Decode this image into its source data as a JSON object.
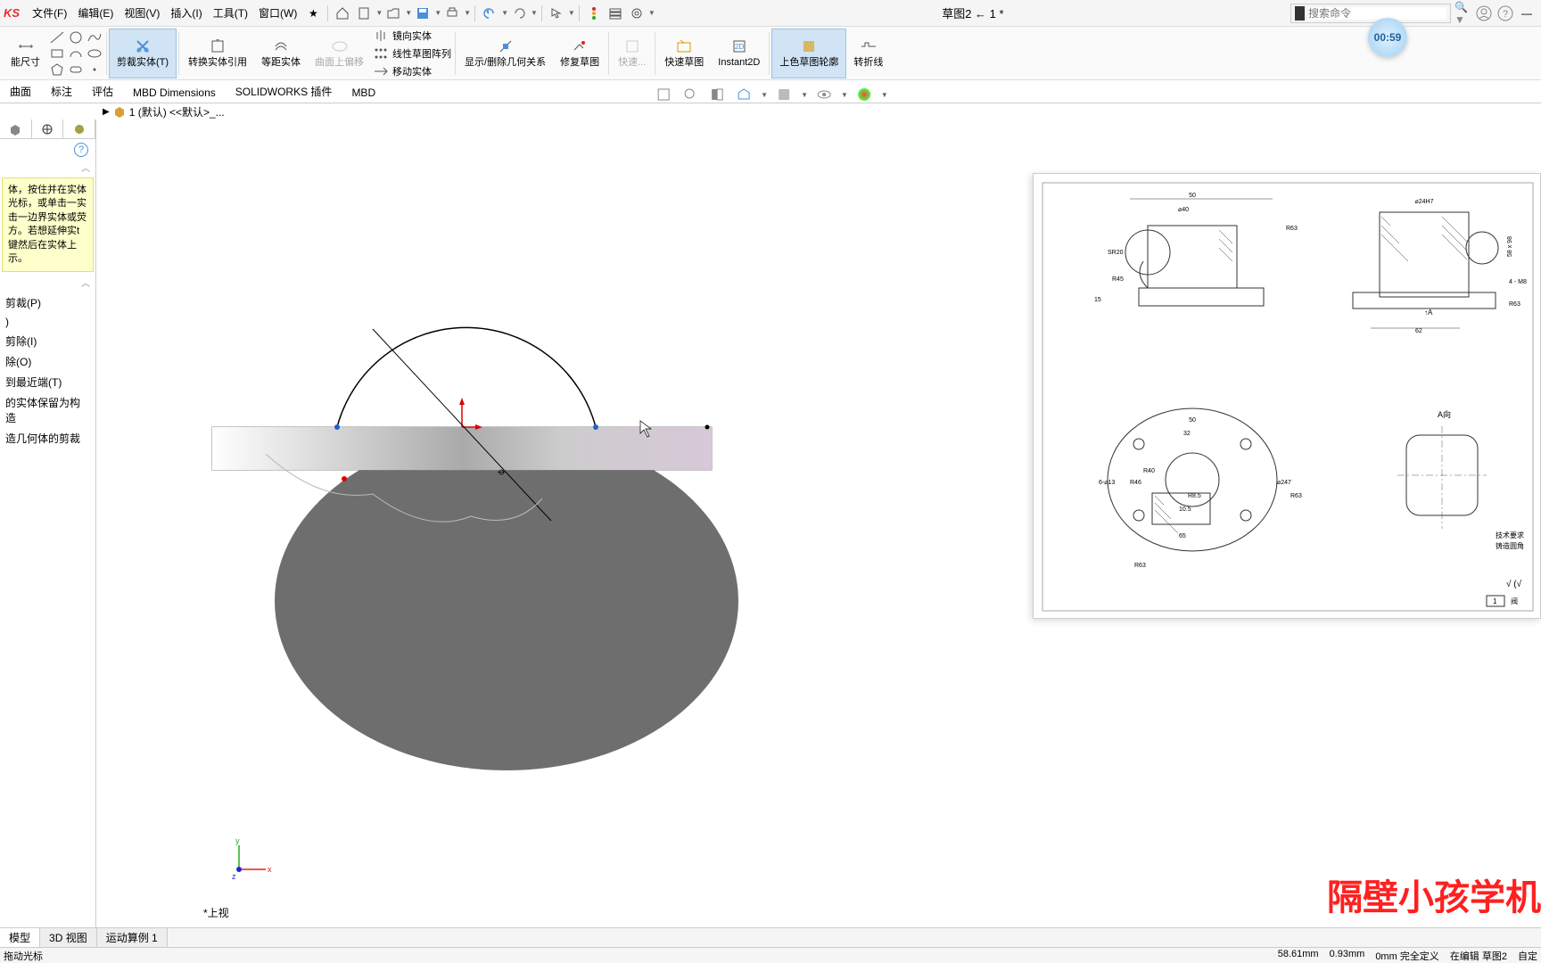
{
  "app": {
    "logo": "KS"
  },
  "menu": {
    "file": "文件(F)",
    "edit": "编辑(E)",
    "view": "视图(V)",
    "insert": "插入(I)",
    "tools": "工具(T)",
    "window": "窗口(W)"
  },
  "doc_title": "草图2 ← 1 *",
  "search": {
    "placeholder": "搜索命令"
  },
  "timer": "00:59",
  "ribbon": {
    "smart_dim": "能尺寸",
    "trim": "剪裁实体(T)",
    "convert": "转换实体引用",
    "offset": "等距实体",
    "surface_offset": "曲面上偏移",
    "mirror": "镜向实体",
    "linear_pattern": "线性草图阵列",
    "move": "移动实体",
    "show_relations": "显示/删除几何关系",
    "repair": "修复草图",
    "quick": "快速...",
    "quick_sketch": "快速草图",
    "instant2d": "Instant2D",
    "shaded": "上色草图轮廓",
    "pierce": "转折线"
  },
  "tabs": {
    "t1": "曲面",
    "t2": "标注",
    "t3": "评估",
    "t4": "MBD Dimensions",
    "t5": "SOLIDWORKS 插件",
    "t6": "MBD"
  },
  "breadcrumb": "1 (默认) <<默认>_...",
  "tooltip_text": "体，按住并在实体光标，或单击一实击一边界实体或荧方。若想延伸实t 键然后在实体上示。",
  "left_items": {
    "i1": "剪裁(P)",
    "i2": ")",
    "i3": "剪除(I)",
    "i4": "除(O)",
    "i5": "到最近端(T)",
    "i6": "的实体保留为构造",
    "i7": "造几何体的剪裁"
  },
  "view_label": "*上视",
  "bottom_tabs": {
    "b1": "模型",
    "b2": "3D 视图",
    "b3": "运动算例 1"
  },
  "status": {
    "left": "拖动光标",
    "coord": "58.61mm",
    "y": "0.93mm",
    "z": "0mm 完全定义",
    "edit": "在编辑 草图2",
    "auto": "自定"
  },
  "watermark": "隔壁小孩学机"
}
